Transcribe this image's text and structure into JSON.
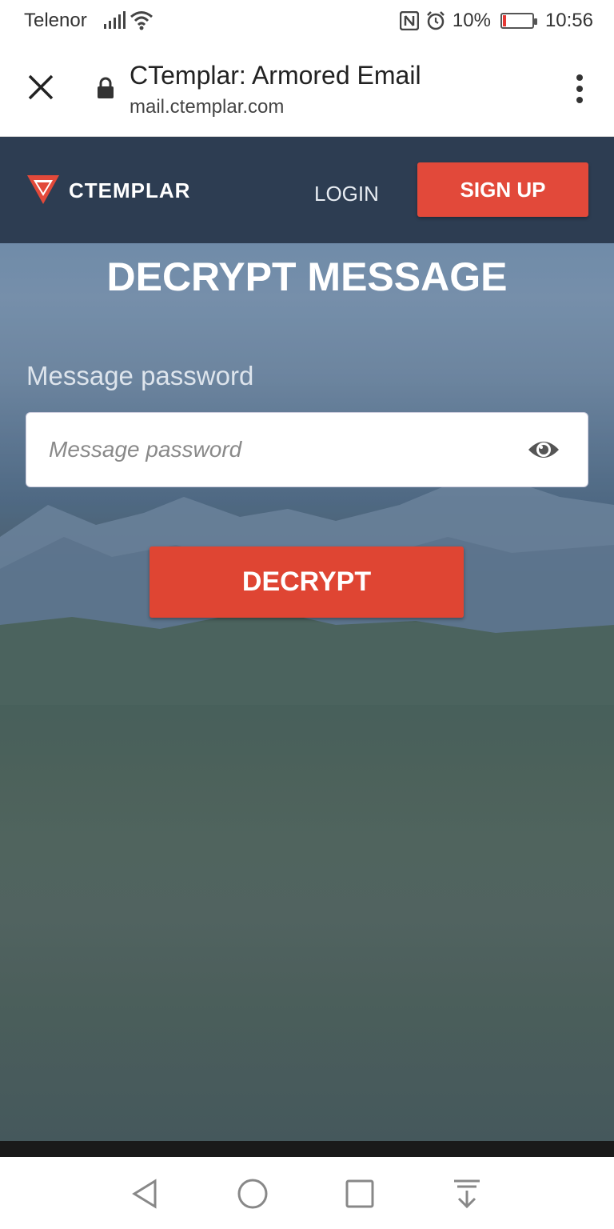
{
  "status_bar": {
    "carrier": "Telenor",
    "battery": "10%",
    "battery_level": 0.1,
    "time": "10:56",
    "icons": [
      "signal-icon",
      "wifi-icon",
      "nfc-icon",
      "alarm-icon",
      "battery-icon"
    ]
  },
  "browser": {
    "page_title": "CTemplar: Armored Email",
    "url": "mail.ctemplar.com",
    "icons": [
      "close-icon",
      "lock-icon",
      "more-vert-icon"
    ]
  },
  "site_nav": {
    "brand": "CTEMPLAR",
    "login_label": "LOGIN",
    "signup_label": "SIGN UP",
    "accent_color": "#e2493a"
  },
  "main": {
    "heading": "DECRYPT MESSAGE",
    "password_label": "Message password",
    "password_placeholder": "Message password",
    "password_value": "",
    "decrypt_label": "DECRYPT"
  },
  "android_nav": {
    "icons": [
      "back-icon",
      "home-icon",
      "recents-icon",
      "notification-pull-icon"
    ]
  }
}
